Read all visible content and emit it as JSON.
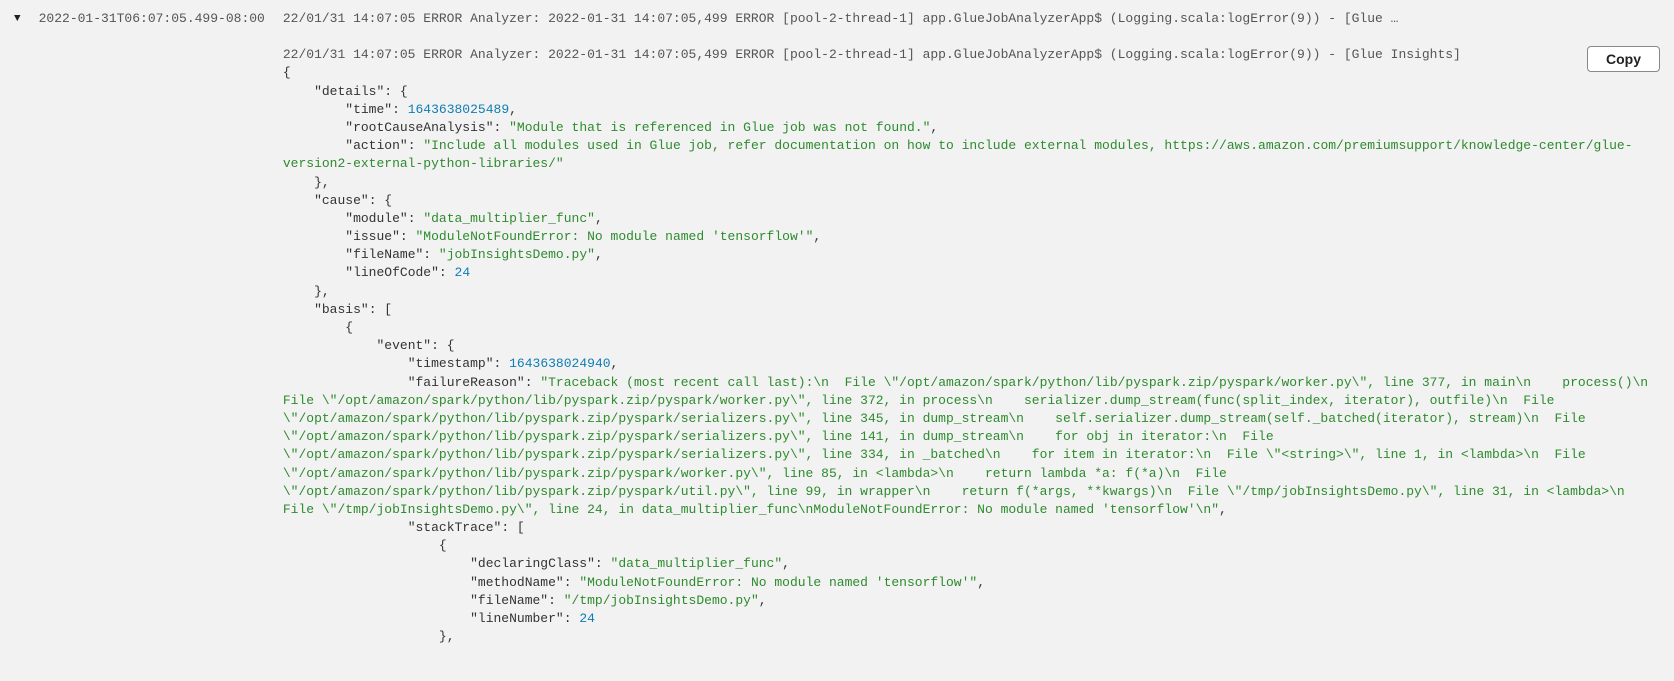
{
  "row": {
    "timestamp": "2022-01-31T06:07:05.499-08:00",
    "summary": "22/01/31 14:07:05 ERROR Analyzer: 2022-01-31 14:07:05,499 ERROR [pool-2-thread-1] app.GlueJobAnalyzerApp$ (Logging.scala:logError(9)) - [Glue …"
  },
  "copy_label": "Copy",
  "detail": {
    "header_line": "22/01/31 14:07:05 ERROR Analyzer: 2022-01-31 14:07:05,499 ERROR [pool-2-thread-1] app.GlueJobAnalyzerApp$ (Logging.scala:logError(9)) - [Glue Insights]",
    "json": {
      "details": {
        "time": 1643638025489,
        "rootCauseAnalysis": "Module that is referenced in Glue job was not found.",
        "action": "Include all modules used in Glue job, refer documentation on how to include external modules, https://aws.amazon.com/premiumsupport/knowledge-center/glue-version2-external-python-libraries/"
      },
      "cause": {
        "module": "data_multiplier_func",
        "issue": "ModuleNotFoundError: No module named 'tensorflow'",
        "fileName": "jobInsightsDemo.py",
        "lineOfCode": 24
      },
      "basis": [
        {
          "event": {
            "timestamp": 1643638024940,
            "failureReason": "Traceback (most recent call last):\\n  File \\\"/opt/amazon/spark/python/lib/pyspark.zip/pyspark/worker.py\\\", line 377, in main\\n    process()\\n  File \\\"/opt/amazon/spark/python/lib/pyspark.zip/pyspark/worker.py\\\", line 372, in process\\n    serializer.dump_stream(func(split_index, iterator), outfile)\\n  File \\\"/opt/amazon/spark/python/lib/pyspark.zip/pyspark/serializers.py\\\", line 345, in dump_stream\\n    self.serializer.dump_stream(self._batched(iterator), stream)\\n  File \\\"/opt/amazon/spark/python/lib/pyspark.zip/pyspark/serializers.py\\\", line 141, in dump_stream\\n    for obj in iterator:\\n  File \\\"/opt/amazon/spark/python/lib/pyspark.zip/pyspark/serializers.py\\\", line 334, in _batched\\n    for item in iterator:\\n  File \\\"<string>\\\", line 1, in <lambda>\\n  File \\\"/opt/amazon/spark/python/lib/pyspark.zip/pyspark/worker.py\\\", line 85, in <lambda>\\n    return lambda *a: f(*a)\\n  File \\\"/opt/amazon/spark/python/lib/pyspark.zip/pyspark/util.py\\\", line 99, in wrapper\\n    return f(*args, **kwargs)\\n  File \\\"/tmp/jobInsightsDemo.py\\\", line 31, in <lambda>\\n  File \\\"/tmp/jobInsightsDemo.py\\\", line 24, in data_multiplier_func\\nModuleNotFoundError: No module named 'tensorflow'\\n",
            "stackTrace": [
              {
                "declaringClass": "data_multiplier_func",
                "methodName": "ModuleNotFoundError: No module named 'tensorflow'",
                "fileName": "/tmp/jobInsightsDemo.py",
                "lineNumber": 24
              }
            ]
          }
        }
      ]
    }
  }
}
